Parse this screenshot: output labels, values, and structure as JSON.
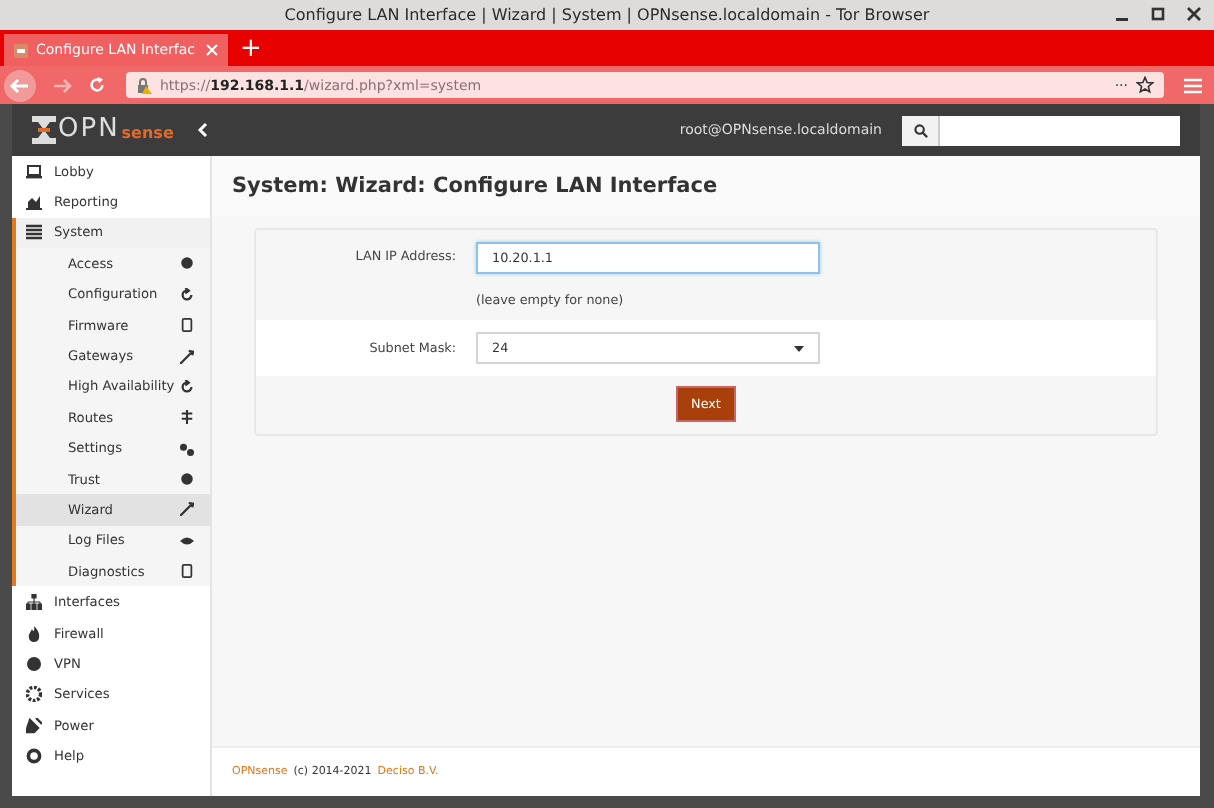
{
  "window": {
    "title": "Configure LAN Interface | Wizard | System | OPNsense.localdomain - Tor Browser"
  },
  "tabs": [
    {
      "label": "Configure LAN Interfac",
      "selected": true
    }
  ],
  "new_tab": "+",
  "address_bar": {
    "url": "https://**192.168.1.1**/wizard.php?xml=system",
    "more": "···"
  },
  "header": {
    "logo_main": "OPN",
    "logo_accent": "sense",
    "user": "root@OPNsense.localdomain"
  },
  "sidebar": {
    "items": [
      {
        "label": "Lobby",
        "selected": false
      },
      {
        "label": "Reporting",
        "selected": false
      },
      {
        "label": "System",
        "selected": false,
        "expanded": true,
        "children": [
          {
            "label": "Access",
            "selected": false
          },
          {
            "label": "Configuration",
            "selected": false
          },
          {
            "label": "Firmware",
            "selected": false
          },
          {
            "label": "Gateways",
            "selected": false
          },
          {
            "label": "High Availability",
            "selected": false
          },
          {
            "label": "Routes",
            "selected": false
          },
          {
            "label": "Settings",
            "selected": false
          },
          {
            "label": "Trust",
            "selected": false
          },
          {
            "label": "Wizard",
            "selected": true
          },
          {
            "label": "Log Files",
            "selected": false
          },
          {
            "label": "Diagnostics",
            "selected": false
          }
        ]
      },
      {
        "label": "Interfaces",
        "selected": false
      },
      {
        "label": "Firewall",
        "selected": false
      },
      {
        "label": "VPN",
        "selected": false
      },
      {
        "label": "Services",
        "selected": false
      },
      {
        "label": "Power",
        "selected": false
      },
      {
        "label": "Help",
        "selected": false
      }
    ]
  },
  "page": {
    "title": "System: Wizard: Configure LAN Interface",
    "form": {
      "ip_label": "LAN IP Address:",
      "ip_value": "10.20.1.1",
      "ip_hint": "(leave empty for none)",
      "mask_label": "Subnet Mask:",
      "mask_value": "24",
      "next_button": "Next"
    }
  },
  "footer": {
    "product_link": "OPNsense",
    "copyright": "(c) 2014-2021",
    "company_link": "Deciso B.V."
  }
}
